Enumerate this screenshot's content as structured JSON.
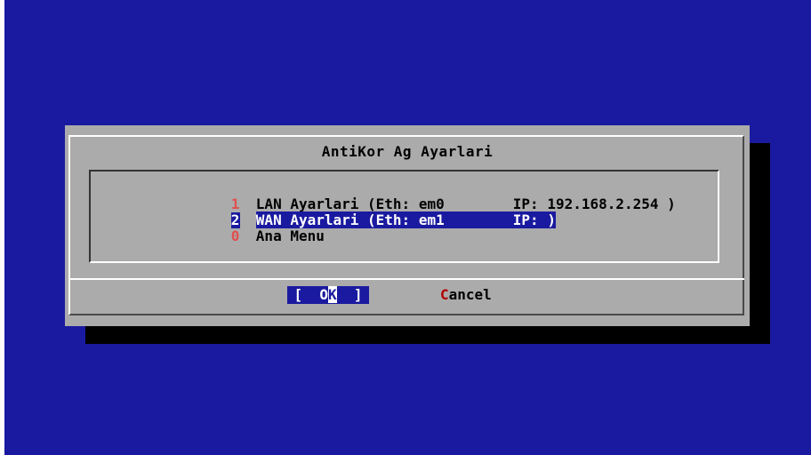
{
  "dialog": {
    "title": "AntiKor Ag Ayarlari"
  },
  "menu": {
    "items": [
      {
        "key": "1",
        "label": "LAN Ayarlari (Eth: em0        IP: 192.168.2.254 )",
        "selected": false
      },
      {
        "key": "2",
        "label": "WAN Ayarlari (Eth: em1        IP: )",
        "selected": true
      },
      {
        "key": "0",
        "label": "Ana Menu",
        "selected": false
      }
    ]
  },
  "buttons": {
    "ok": {
      "open": "[",
      "pre": "  ",
      "hot": "O",
      "cursor": "K",
      "post": "  ",
      "close": "]"
    },
    "cancel": {
      "hot": "C",
      "rest": "ancel"
    }
  },
  "colors": {
    "screen_bg": "#1a1aa0",
    "dialog_bg": "#ababab",
    "hotkey": "#e05050",
    "selection_bg": "#1a1aa0"
  }
}
